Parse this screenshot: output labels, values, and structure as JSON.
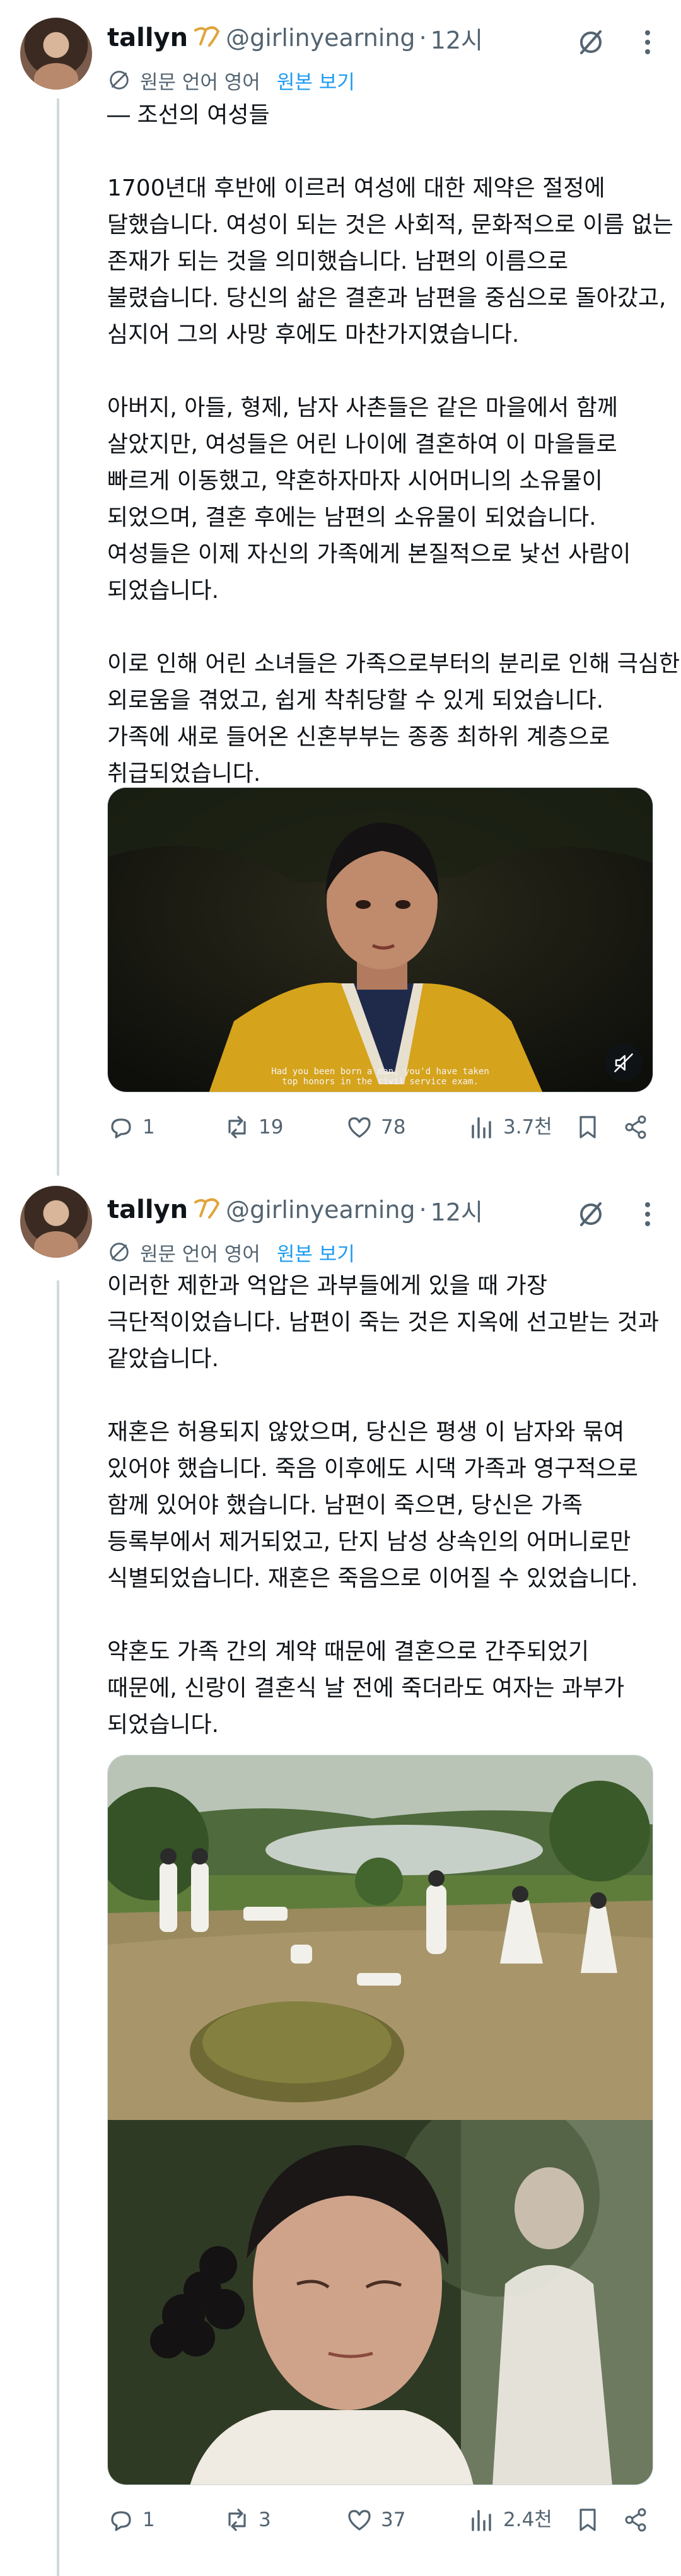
{
  "tweets": [
    {
      "user": {
        "name": "tallyn",
        "handle": "@girlinyearning",
        "time": "12시"
      },
      "translation": {
        "label": "원문 언어 영어",
        "link": "원본 보기"
      },
      "text": [
        "― 조선의 여성들",
        "",
        "1700년대 후반에 이르러 여성에 대한 제약은 절정에",
        "달했습니다. 여성이 되는 것은 사회적, 문화적으로 이름 없는",
        "존재가 되는 것을 의미했습니다. 남편의 이름으로",
        "불렸습니다. 당신의 삶은 결혼과 남편을 중심으로 돌아갔고,",
        "심지어 그의 사망 후에도 마찬가지였습니다.",
        "",
        "아버지, 아들, 형제, 남자 사촌들은 같은 마을에서 함께",
        "살았지만, 여성들은 어린 나이에 결혼하여 이 마을들로",
        "빠르게 이동했고, 약혼하자마자 시어머니의 소유물이",
        "되었으며, 결혼 후에는 남편의 소유물이 되었습니다.",
        "여성들은 이제 자신의 가족에게 본질적으로 낯선 사람이",
        "되었습니다.",
        "",
        "이로 인해 어린 소녀들은 가족으로부터의 분리로 인해 극심한",
        "외로움을 겪었고, 쉽게 착취당할 수 있게 되었습니다.",
        "가족에 새로 들어온 신혼부부는 종종 최하위 계층으로",
        "취급되었습니다."
      ],
      "media": {
        "subtitle_line1": "Had you been born a man, you'd have taken",
        "subtitle_line2": "top honors in the civil service exam."
      },
      "stats": {
        "replies": "1",
        "retweets": "19",
        "likes": "78",
        "views": "3.7천"
      }
    },
    {
      "user": {
        "name": "tallyn",
        "handle": "@girlinyearning",
        "time": "12시"
      },
      "translation": {
        "label": "원문 언어 영어",
        "link": "원본 보기"
      },
      "text": [
        "이러한 제한과 억압은 과부들에게 있을 때 가장",
        "극단적이었습니다. 남편이 죽는 것은 지옥에 선고받는 것과",
        "같았습니다.",
        "",
        "재혼은 허용되지 않았으며, 당신은 평생 이 남자와 묶여",
        "있어야 했습니다. 죽음 이후에도 시댁 가족과 영구적으로",
        "함께 있어야 했습니다. 남편이 죽으면, 당신은 가족",
        "등록부에서 제거되었고, 단지 남성 상속인의 어머니로만",
        "식별되었습니다. 재혼은 죽음으로 이어질 수 있었습니다.",
        "",
        "약혼도 가족 간의 계약 때문에 결혼으로 간주되었기",
        "때문에, 신랑이 결혼식 날 전에 죽더라도 여자는 과부가",
        "되었습니다."
      ],
      "stats": {
        "replies": "1",
        "retweets": "3",
        "likes": "37",
        "views": "2.4천"
      }
    }
  ],
  "colors": {
    "secondary": "#536471",
    "link": "#1d9bf0",
    "text": "#0f1419",
    "divider": "#cfd9de"
  }
}
